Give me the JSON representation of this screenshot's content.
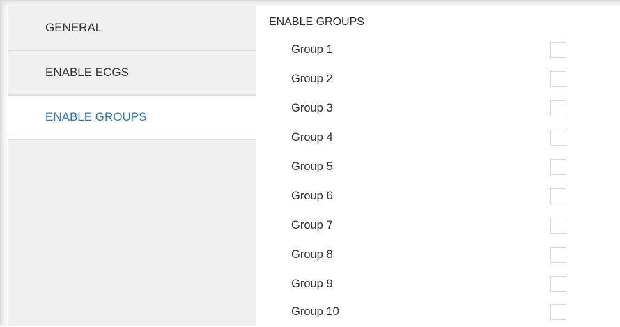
{
  "sidebar": {
    "items": [
      {
        "label": "GENERAL",
        "active": false
      },
      {
        "label": "ENABLE ECGS",
        "active": false
      },
      {
        "label": "ENABLE GROUPS",
        "active": true
      }
    ]
  },
  "main": {
    "title": "ENABLE GROUPS",
    "groups": [
      {
        "label": "Group 1",
        "checked": false
      },
      {
        "label": "Group 2",
        "checked": false
      },
      {
        "label": "Group 3",
        "checked": false
      },
      {
        "label": "Group 4",
        "checked": false
      },
      {
        "label": "Group 5",
        "checked": false
      },
      {
        "label": "Group 6",
        "checked": false
      },
      {
        "label": "Group 7",
        "checked": false
      },
      {
        "label": "Group 8",
        "checked": false
      },
      {
        "label": "Group 9",
        "checked": false
      },
      {
        "label": "Group 10",
        "checked": false
      }
    ]
  },
  "colors": {
    "active_text": "#2a78c4",
    "sidebar_bg": "#f0f0f0",
    "text": "#333333"
  }
}
